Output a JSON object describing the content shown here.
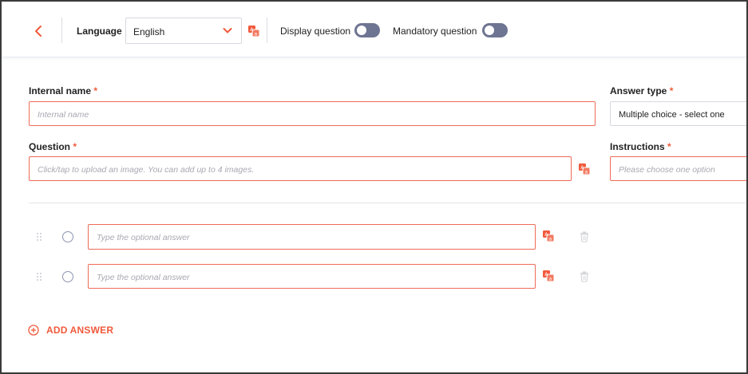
{
  "header": {
    "language_label": "Language",
    "language_value": "English",
    "display_question_label": "Display question",
    "display_question_on": false,
    "mandatory_question_label": "Mandatory question",
    "mandatory_question_on": false
  },
  "form": {
    "internal_name": {
      "label": "Internal name",
      "required_mark": "*",
      "placeholder": "Internal name"
    },
    "answer_type": {
      "label": "Answer type",
      "required_mark": "*",
      "value": "Multiple choice - select one"
    },
    "question": {
      "label": "Question",
      "required_mark": "*",
      "placeholder": "Click/tap to upload an image. You can add up to 4 images."
    },
    "instructions": {
      "label": "Instructions",
      "required_mark": "*",
      "placeholder": "Please choose one option"
    }
  },
  "answers": [
    {
      "placeholder": "Type the optional answer"
    },
    {
      "placeholder": "Type the optional answer"
    }
  ],
  "add_answer_label": "ADD ANSWER",
  "colors": {
    "accent": "#f05a3c",
    "field_border": "#ef6b58",
    "toggle_off": "#6e7592"
  },
  "icons": [
    "back-arrow-icon",
    "chevron-down-icon",
    "translate-icon",
    "drag-handle-icon",
    "trash-icon",
    "add-circle-icon"
  ]
}
